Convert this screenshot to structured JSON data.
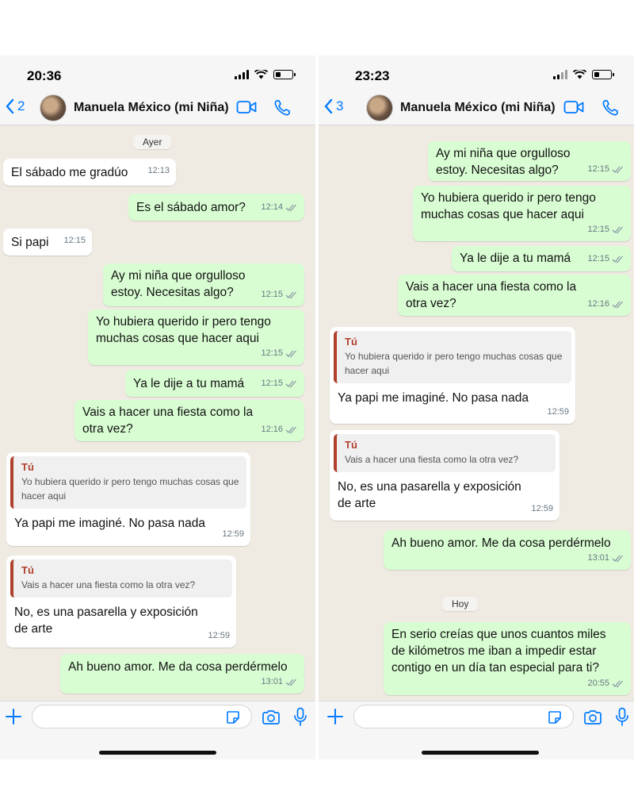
{
  "left": {
    "status_time": "20:36",
    "back_count": "2",
    "contact_name": "Manuela México (mi Niña)",
    "date_chip": "Ayer",
    "messages": [
      {
        "text": "El sábado me gradúo",
        "time": "12:13",
        "dir": "in"
      },
      {
        "text": "Es el sábado amor?",
        "time": "12:14",
        "dir": "out"
      },
      {
        "text": "Si papi",
        "time": "12:15",
        "dir": "in"
      },
      {
        "text": "Ay mi niña que orgulloso estoy. Necesitas algo?",
        "time": "12:15",
        "dir": "out"
      },
      {
        "text": "Yo hubiera querido ir pero tengo muchas cosas que hacer aqui",
        "time": "12:15",
        "dir": "out"
      },
      {
        "text": "Ya le dije a tu mamá",
        "time": "12:15",
        "dir": "out"
      },
      {
        "text": "Vais a hacer una fiesta como la otra vez?",
        "time": "12:16",
        "dir": "out"
      },
      {
        "quote_author": "Tú",
        "quote_text": "Yo hubiera querido ir pero tengo muchas cosas que hacer aqui",
        "text": "Ya papi me imaginé. No pasa nada",
        "time": "12:59",
        "dir": "in"
      },
      {
        "quote_author": "Tú",
        "quote_text": "Vais a hacer una fiesta como la otra vez?",
        "text": "No, es una pasarella y exposición de arte",
        "time": "12:59",
        "dir": "in"
      },
      {
        "text": "Ah bueno amor. Me da cosa perdérmelo",
        "time": "13:01",
        "dir": "out"
      }
    ]
  },
  "right": {
    "status_time": "23:23",
    "back_count": "3",
    "contact_name": "Manuela México (mi Niña)",
    "date_chip": "Hoy",
    "messages": [
      {
        "text": "Ay mi niña que orgulloso estoy. Necesitas algo?",
        "time": "12:15",
        "dir": "out"
      },
      {
        "text": "Yo hubiera querido ir pero tengo muchas cosas que hacer aqui",
        "time": "12:15",
        "dir": "out"
      },
      {
        "text": "Ya le dije a tu mamá",
        "time": "12:15",
        "dir": "out"
      },
      {
        "text": "Vais a hacer una fiesta como la otra vez?",
        "time": "12:16",
        "dir": "out"
      },
      {
        "quote_author": "Tú",
        "quote_text": "Yo hubiera querido ir pero tengo muchas cosas que hacer aqui",
        "text": "Ya papi me imaginé. No pasa nada",
        "time": "12:59",
        "dir": "in"
      },
      {
        "quote_author": "Tú",
        "quote_text": "Vais a hacer una fiesta como la otra vez?",
        "text": "No, es una pasarella y exposición de arte",
        "time": "12:59",
        "dir": "in"
      },
      {
        "text": "Ah bueno amor. Me da cosa perdérmelo",
        "time": "13:01",
        "dir": "out"
      },
      {
        "text": "En serio creías que unos cuantos miles de kilómetros me iban a impedir estar contigo en un día tan especial para ti?",
        "time": "20:55",
        "dir": "out"
      }
    ]
  },
  "colors": {
    "accent": "#007aff",
    "outgoing_bubble": "#d9fdd3",
    "incoming_bubble": "#ffffff",
    "chat_background": "#efeae2",
    "quote_accent": "#b0412d"
  },
  "icons": [
    "chevron-left-icon",
    "video-call-icon",
    "phone-icon",
    "plus-icon",
    "sticker-icon",
    "camera-icon",
    "microphone-icon",
    "read-ticks-icon",
    "wifi-icon",
    "signal-icon",
    "battery-icon"
  ]
}
